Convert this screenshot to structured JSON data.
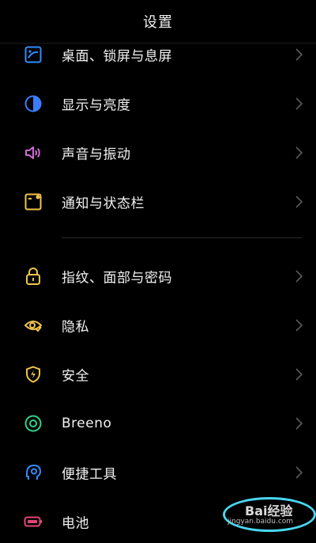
{
  "header": {
    "title": "设置"
  },
  "items": [
    {
      "label": "桌面、锁屏与息屏",
      "icon": "wallpaper-icon",
      "color": "#2f8cff"
    },
    {
      "label": "显示与亮度",
      "icon": "display-icon",
      "color": "#3b7dff"
    },
    {
      "label": "声音与振动",
      "icon": "speaker-icon",
      "color": "#d36ad8"
    },
    {
      "label": "通知与状态栏",
      "icon": "notification-icon",
      "color": "#f0c44a"
    },
    {
      "label": "指纹、面部与密码",
      "icon": "lock-icon",
      "color": "#f0c44a"
    },
    {
      "label": "隐私",
      "icon": "privacy-eye-icon",
      "color": "#f0c44a"
    },
    {
      "label": "安全",
      "icon": "security-shield-icon",
      "color": "#f0c44a"
    },
    {
      "label": "Breeno",
      "icon": "breeno-icon",
      "color": "#2fd38a"
    },
    {
      "label": "便捷工具",
      "icon": "tools-icon",
      "color": "#2f8cff"
    },
    {
      "label": "电池",
      "icon": "battery-icon",
      "color": "#e0457a"
    }
  ],
  "watermark": {
    "brand": "Bai经验",
    "url": "jingyan.baidu.com"
  }
}
